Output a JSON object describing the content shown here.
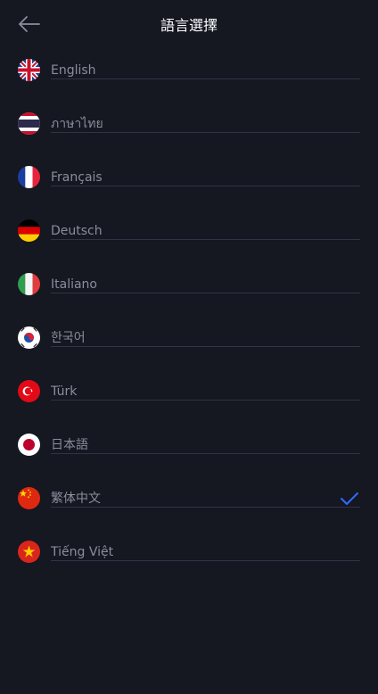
{
  "header": {
    "title": "語言選擇"
  },
  "languages": [
    {
      "label": "English",
      "flag": "uk-flag-icon",
      "selected": false
    },
    {
      "label": "ภาษาไทย",
      "flag": "thailand-flag-icon",
      "selected": false
    },
    {
      "label": "Français",
      "flag": "france-flag-icon",
      "selected": false
    },
    {
      "label": "Deutsch",
      "flag": "germany-flag-icon",
      "selected": false
    },
    {
      "label": "Italiano",
      "flag": "italy-flag-icon",
      "selected": false
    },
    {
      "label": "한국어",
      "flag": "korea-flag-icon",
      "selected": false
    },
    {
      "label": "Türk",
      "flag": "turkey-flag-icon",
      "selected": false
    },
    {
      "label": "日本語",
      "flag": "japan-flag-icon",
      "selected": false
    },
    {
      "label": "繁体中文",
      "flag": "china-flag-icon",
      "selected": true
    },
    {
      "label": "Tiếng Việt",
      "flag": "vietnam-flag-icon",
      "selected": false
    }
  ],
  "colors": {
    "background": "#151721",
    "label": "#8a8e9c",
    "divider": "#303447",
    "check": "#2f6bff"
  }
}
